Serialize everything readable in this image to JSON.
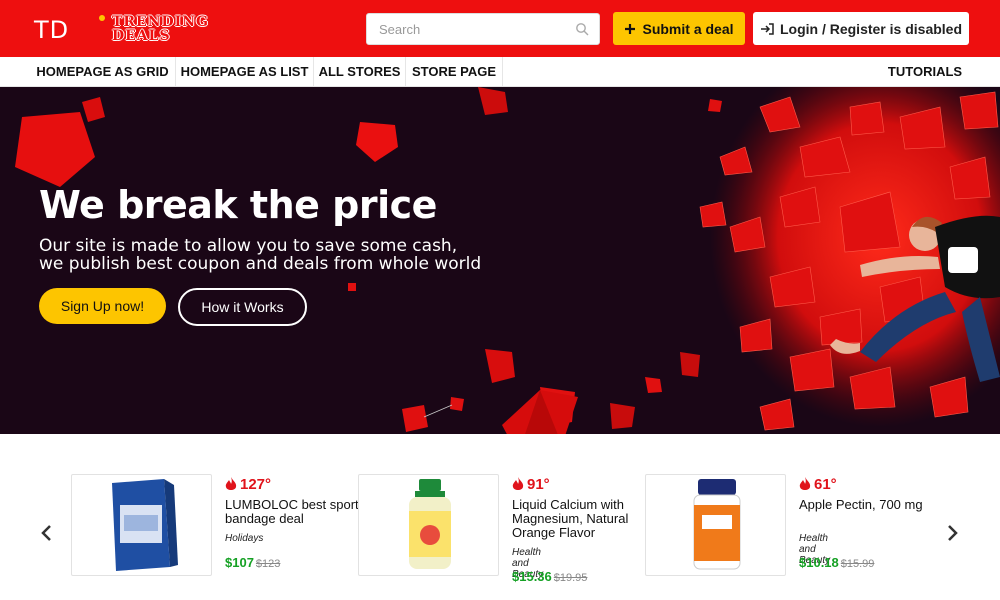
{
  "header": {
    "logo": {
      "prefix": "TD",
      "line1": "TRENDING",
      "line2": "DEALS"
    },
    "search": {
      "placeholder": "Search",
      "value": ""
    },
    "submit_label": "Submit a deal",
    "login_label": "Login / Register is disabled"
  },
  "nav": {
    "items": [
      "HOMEPAGE AS GRID",
      "HOMEPAGE AS LIST",
      "ALL STORES",
      "STORE PAGE"
    ],
    "right": "TUTORIALS"
  },
  "hero": {
    "title": "We break the price",
    "subtitle_line1": "Our site is made to allow you to save some cash,",
    "subtitle_line2": "we publish best coupon and deals from whole world",
    "signup_label": "Sign Up now!",
    "how_label": "How it Works",
    "colors": {
      "background": "#1a0616",
      "accent": "#ee0f0f",
      "button": "#fdc500"
    }
  },
  "deals": [
    {
      "score": "127°",
      "title": "LUMBOLOC best sport bandage deal",
      "category": "Holidays",
      "price": "$107",
      "old_price": "$123",
      "image_icon": "bandage-box-icon"
    },
    {
      "score": "91°",
      "title": "Liquid Calcium with Magnesium, Natural Orange Flavor",
      "category": "Health and Beauty",
      "price": "$15.36",
      "old_price": "$19.95",
      "image_icon": "calcium-bottle-icon"
    },
    {
      "score": "61°",
      "title": "Apple Pectin, 700 mg",
      "category": "Health and Beauty",
      "price": "$10.18",
      "old_price": "$15.99",
      "image_icon": "pectin-bottle-icon"
    }
  ],
  "colors": {
    "header_red": "#ee0f0f",
    "price_green": "#15a124",
    "hot_red": "#e0131b"
  }
}
